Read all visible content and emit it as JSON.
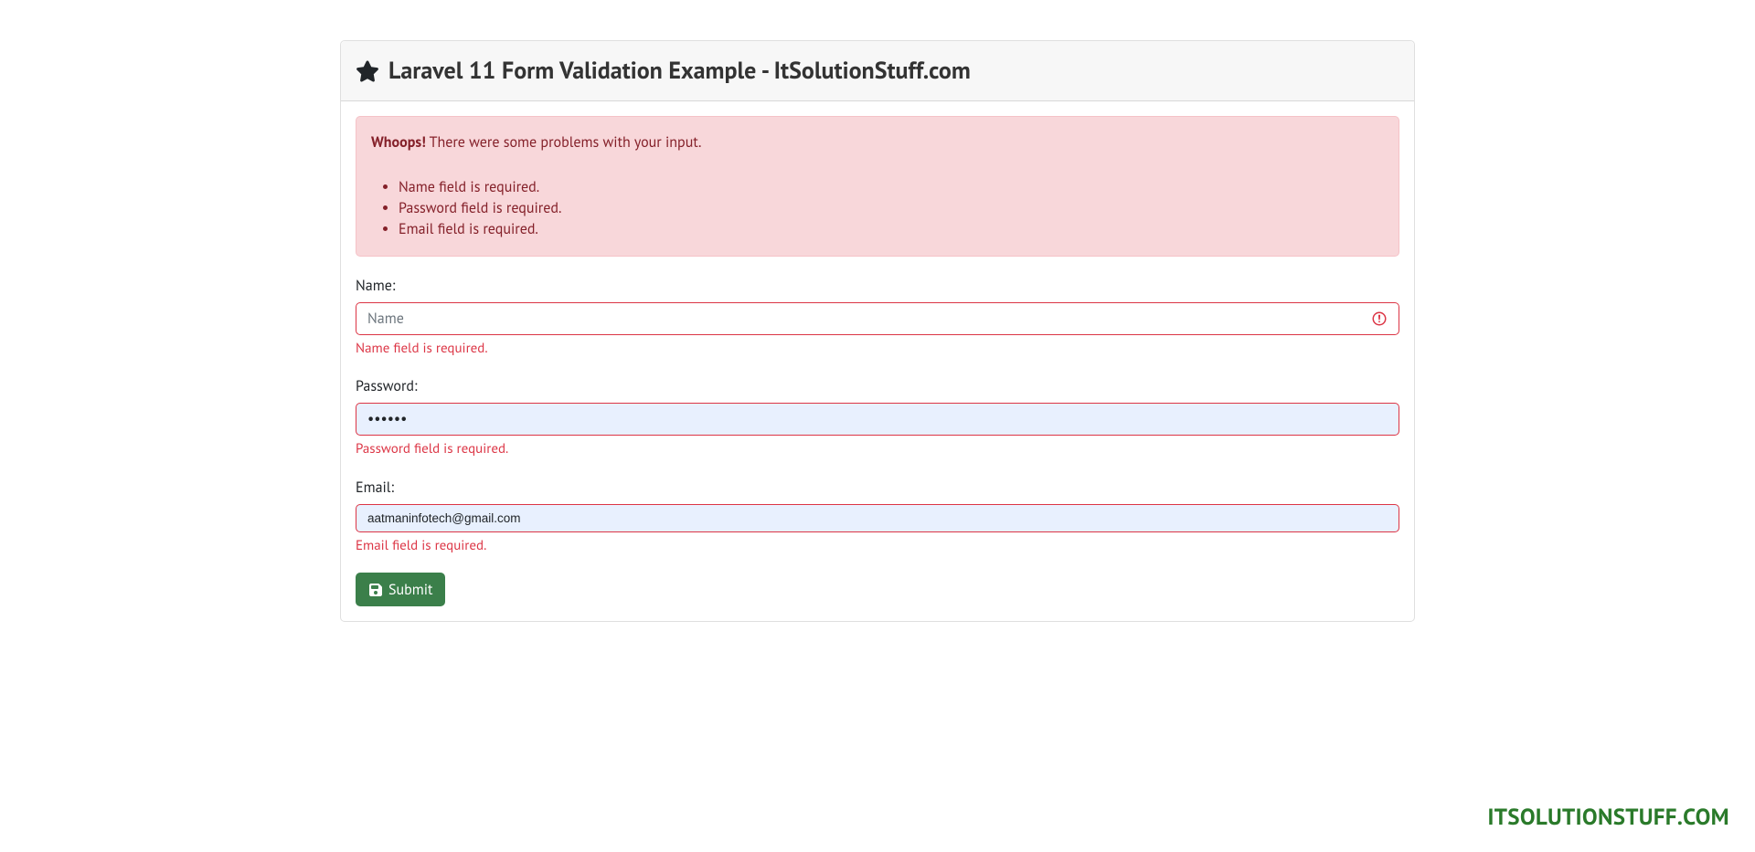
{
  "header": {
    "title": "Laravel 11 Form Validation Example - ItSolutionStuff.com"
  },
  "alert": {
    "strong": "Whoops!",
    "text": " There were some problems with your input.",
    "errors": [
      "Name field is required.",
      "Password field is required.",
      "Email field is required."
    ]
  },
  "form": {
    "name": {
      "label": "Name:",
      "placeholder": "Name",
      "value": "",
      "error": "Name field is required."
    },
    "password": {
      "label": "Password:",
      "value": "••••••",
      "error": "Password field is required."
    },
    "email": {
      "label": "Email:",
      "value": "aatmaninfotech@gmail.com",
      "error": "Email field is required."
    },
    "submit_label": " Submit"
  },
  "watermark": "ITSOLUTIONSTUFF.COM"
}
